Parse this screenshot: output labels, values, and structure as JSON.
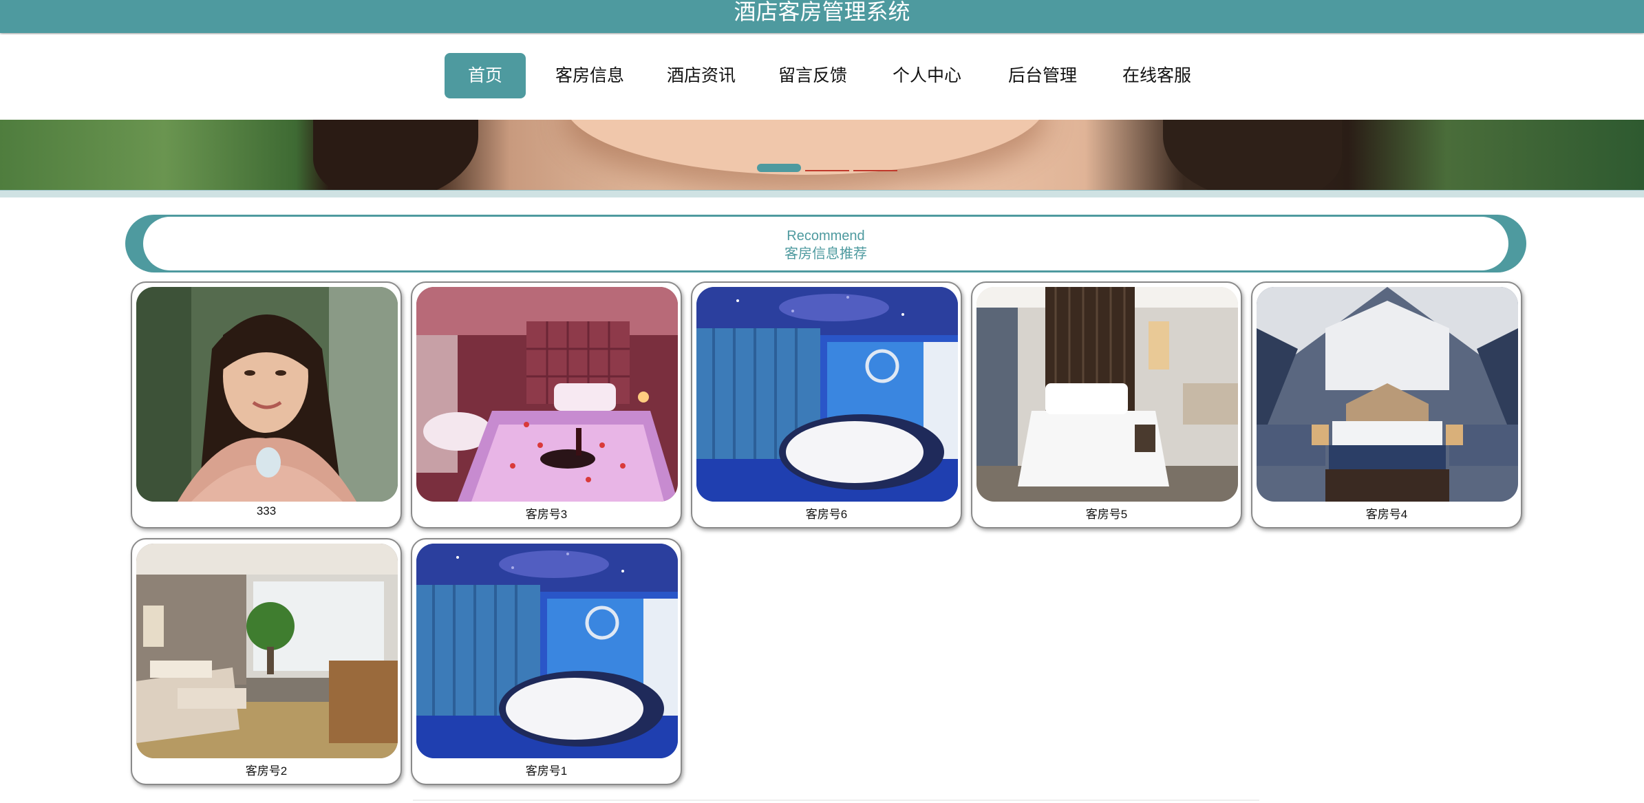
{
  "app": {
    "title": "酒店客房管理系统"
  },
  "nav": {
    "items": [
      {
        "label": "首页",
        "active": true
      },
      {
        "label": "客房信息",
        "active": false
      },
      {
        "label": "酒店资讯",
        "active": false
      },
      {
        "label": "留言反馈",
        "active": false
      },
      {
        "label": "个人中心",
        "active": false
      },
      {
        "label": "后台管理",
        "active": false
      },
      {
        "label": "在线客服",
        "active": false
      }
    ]
  },
  "carousel": {
    "slide_count": 3,
    "active_index": 0
  },
  "section": {
    "title_en": "Recommend",
    "title_cn": "客房信息推荐"
  },
  "cards": [
    {
      "label": "333",
      "image": "woman-portrait-photo"
    },
    {
      "label": "客房号3",
      "image": "pink-romantic-room-photo"
    },
    {
      "label": "客房号6",
      "image": "ocean-theme-room-photo"
    },
    {
      "label": "客房号5",
      "image": "modern-white-room-photo"
    },
    {
      "label": "客房号4",
      "image": "river-mural-room-photo"
    },
    {
      "label": "客房号2",
      "image": "twin-bed-room-photo"
    },
    {
      "label": "客房号1",
      "image": "ocean-theme-room-photo"
    }
  ],
  "colors": {
    "accent": "#4e9a9f",
    "inactive_dot": "#c0392b"
  }
}
